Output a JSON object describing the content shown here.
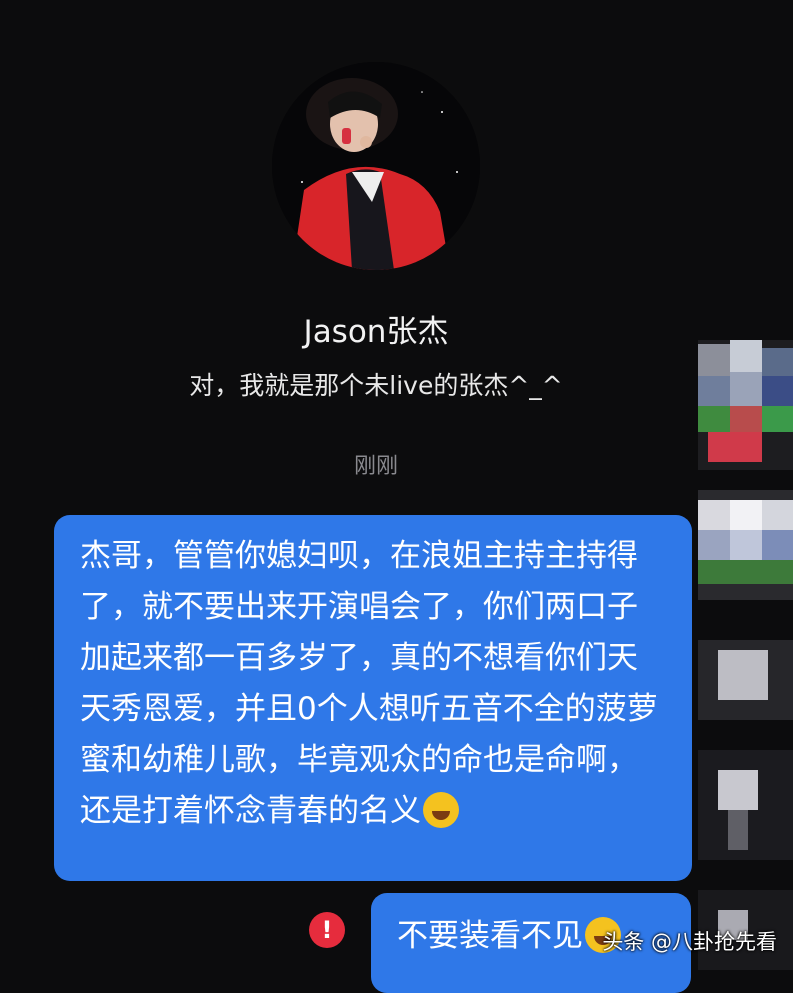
{
  "profile": {
    "name": "Jason张杰",
    "bio": "对，我就是那个未live的张杰^_^",
    "timestamp": "刚刚"
  },
  "messages": [
    {
      "text": "杰哥，管管你媳妇呗，在浪姐主持主持得了，就不要出来开演唱会了，你们两口子加起来都一百多岁了，真的不想看你们天天秀恩爱，并且0个人想听五音不全的菠萝蜜和幼稚儿歌，毕竟观众的命也是命啊，还是打着怀念青春的名义",
      "emoji": "crying-laughing-emoji"
    },
    {
      "text": "不要装看不见",
      "emoji": "smiling-emoji",
      "status": "alert-icon"
    }
  ],
  "alert_symbol": "!",
  "watermark": "头条 @八卦抢先看",
  "colors": {
    "background": "#0c0c0d",
    "bubble": "#2f78e8",
    "alert": "#e62c3d"
  }
}
